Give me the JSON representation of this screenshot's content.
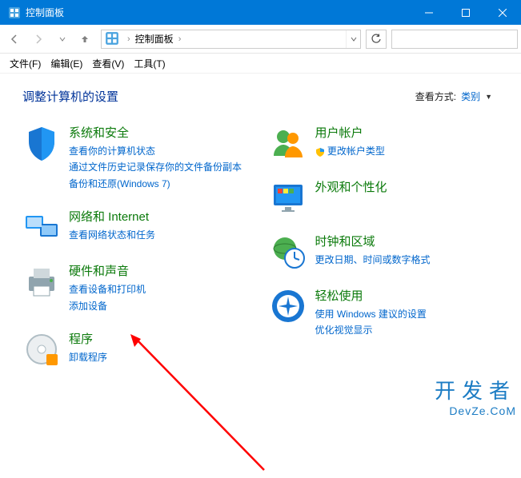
{
  "window": {
    "title": "控制面板",
    "min_icon": "minimize-icon",
    "max_icon": "maximize-icon",
    "close_icon": "close-icon"
  },
  "nav": {
    "breadcrumb_root": "控制面板",
    "search_placeholder": ""
  },
  "menu": {
    "file": "文件(F)",
    "edit": "编辑(E)",
    "view": "查看(V)",
    "tools": "工具(T)"
  },
  "header": {
    "title": "调整计算机的设置",
    "viewby_label": "查看方式:",
    "viewby_value": "类别"
  },
  "categories": {
    "system_security": {
      "title": "系统和安全",
      "links": [
        "查看你的计算机状态",
        "通过文件历史记录保存你的文件备份副本",
        "备份和还原(Windows 7)"
      ]
    },
    "network": {
      "title": "网络和 Internet",
      "links": [
        "查看网络状态和任务"
      ]
    },
    "hardware_sound": {
      "title": "硬件和声音",
      "links": [
        "查看设备和打印机",
        "添加设备"
      ]
    },
    "programs": {
      "title": "程序",
      "links": [
        "卸载程序"
      ]
    },
    "user_accounts": {
      "title": "用户帐户",
      "links": [
        "更改帐户类型"
      ]
    },
    "appearance": {
      "title": "外观和个性化",
      "links": []
    },
    "clock_region": {
      "title": "时钟和区域",
      "links": [
        "更改日期、时间或数字格式"
      ]
    },
    "ease": {
      "title": "轻松使用",
      "links": [
        "使用 Windows 建议的设置",
        "优化视觉显示"
      ]
    }
  },
  "watermark": {
    "line1": "开发者",
    "line2": "DevZe.CoM"
  }
}
